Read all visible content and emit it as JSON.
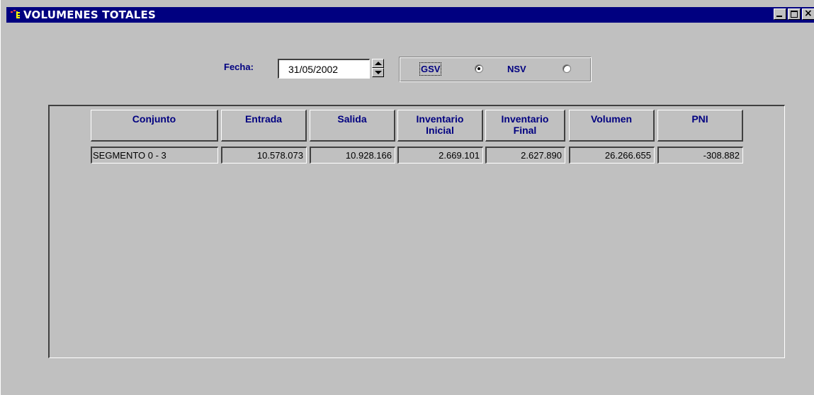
{
  "window": {
    "title": "VOLUMENES TOTALES"
  },
  "controls": {
    "fecha_label": "Fecha:",
    "fecha_value": "31/05/2002",
    "gsv_label": "GSV",
    "nsv_label": "NSV",
    "selected_measure": "GSV"
  },
  "table": {
    "headers": [
      [
        "Conjunto"
      ],
      [
        "Entrada"
      ],
      [
        "Salida"
      ],
      [
        "Inventario",
        "Inicial"
      ],
      [
        "Inventario",
        "Final"
      ],
      [
        "Volumen"
      ],
      [
        "PNI"
      ]
    ],
    "rows": [
      [
        "SEGMENTO 0 - 3",
        "10.578.073",
        "10.928.166",
        "2.669.101",
        "2.627.890",
        "26.266.655",
        "-308.882"
      ]
    ]
  },
  "colors": {
    "titlebar": "#000080",
    "face": "#c0c0c0",
    "label_text": "#000080"
  },
  "icons": [
    "app-icon",
    "minimize-icon",
    "maximize-icon",
    "close-icon",
    "spin-up-icon",
    "spin-down-icon"
  ]
}
